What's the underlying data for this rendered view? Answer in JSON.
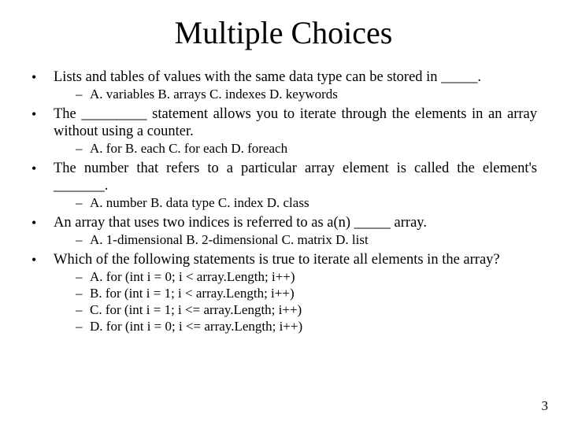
{
  "title": "Multiple Choices",
  "page_number": "3",
  "q1": {
    "text": "Lists and tables of values with the same data type can be stored in _____.",
    "choices": "A. variables   B. arrays    C. indexes   D. keywords"
  },
  "q2": {
    "text": "The _________ statement allows you to iterate through the elements in an array without using a counter.",
    "choices": "A. for        B. each      C. for each    D. foreach"
  },
  "q3": {
    "text": "The number that refers to a particular array element is called the element's _______.",
    "choices": "A. number   B. data type   C. index    D. class"
  },
  "q4": {
    "text": "An array that uses two indices is referred to as a(n) _____ array.",
    "choices": "A. 1-dimensional   B. 2-dimensional   C. matrix   D. list"
  },
  "q5": {
    "text": "Which of the following statements is true to iterate all elements in the array?",
    "a": "A. for (int i = 0; i < array.Length; i++)",
    "b": "B. for (int i = 1; i < array.Length; i++)",
    "c": "C. for (int i = 1; i <= array.Length; i++)",
    "d": "D. for (int i = 0; i <= array.Length; i++)"
  }
}
